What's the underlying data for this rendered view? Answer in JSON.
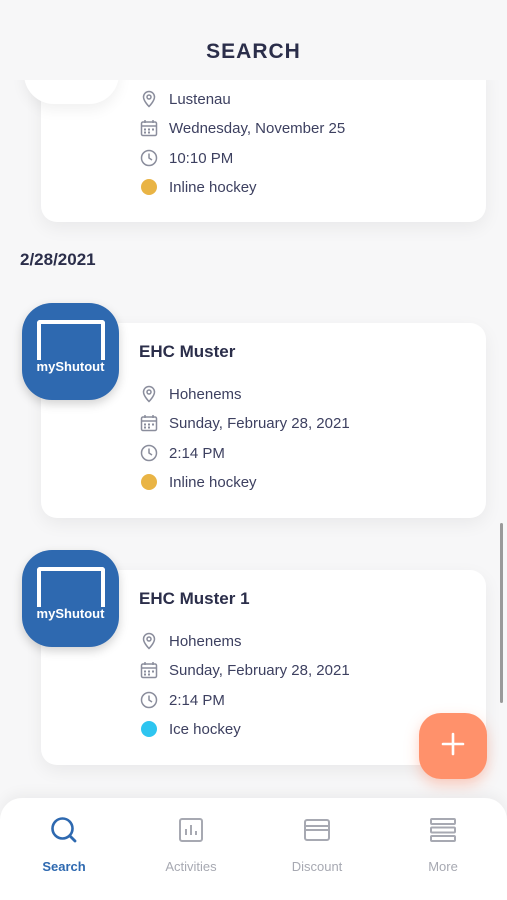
{
  "header": {
    "title": "SEARCH"
  },
  "events_partial": {
    "location": "Lustenau",
    "date": "Wednesday, November 25",
    "time": "10:10 PM",
    "sport": "Inline hockey",
    "sport_color": "#e9b445"
  },
  "date_group": {
    "label": "2/28/2021"
  },
  "events": [
    {
      "logo_text": "myShutout",
      "name": "EHC Muster",
      "location": "Hohenems",
      "date": "Sunday, February 28, 2021",
      "time": "2:14 PM",
      "sport": "Inline hockey",
      "sport_color": "#e9b445"
    },
    {
      "logo_text": "myShutout",
      "name": "EHC Muster 1",
      "location": "Hohenems",
      "date": "Sunday, February 28, 2021",
      "time": "2:14 PM",
      "sport": "Ice hockey",
      "sport_color": "#2ec5f0"
    }
  ],
  "fab": {
    "icon": "plus-icon",
    "color": "#ff916b"
  },
  "tabbar": {
    "items": [
      {
        "label": "Search",
        "icon": "search-icon",
        "active": true
      },
      {
        "label": "Activities",
        "icon": "activities-icon",
        "active": false
      },
      {
        "label": "Discount",
        "icon": "discount-icon",
        "active": false
      },
      {
        "label": "More",
        "icon": "more-icon",
        "active": false
      }
    ]
  },
  "colors": {
    "accent": "#2e69b0",
    "text": "#2b2e4a",
    "muted": "#a7a9b2"
  }
}
